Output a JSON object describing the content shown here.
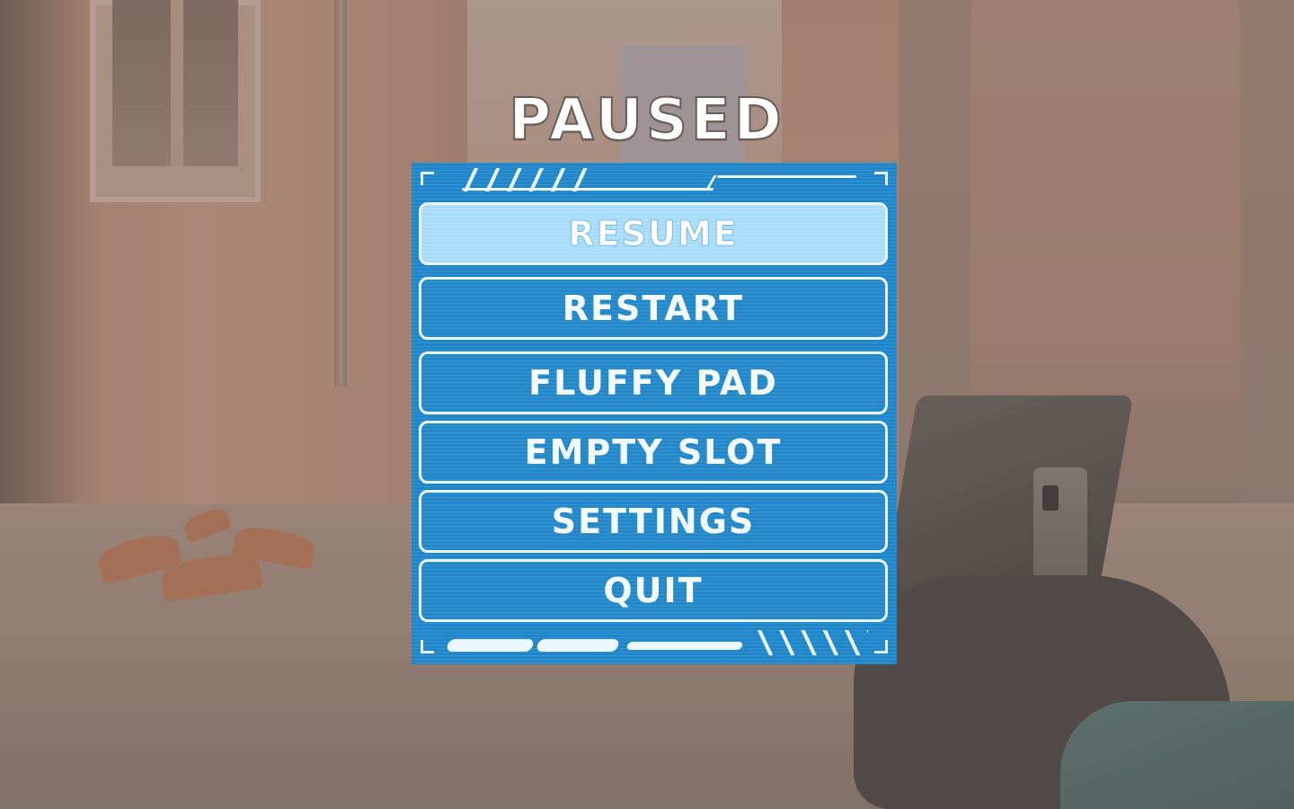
{
  "title": "PAUSED",
  "menu": {
    "selected_index": 0,
    "items": [
      {
        "label": "RESUME"
      },
      {
        "label": "RESTART"
      },
      {
        "label": "FLUFFY PAD"
      },
      {
        "label": "EMPTY SLOT"
      },
      {
        "label": "SETTINGS"
      },
      {
        "label": "QUIT"
      }
    ]
  },
  "colors": {
    "panel": "#1f86c9",
    "selected_item": "#a7dcfb",
    "outline": "#e9f6ff",
    "title_text": "#ffffff"
  }
}
